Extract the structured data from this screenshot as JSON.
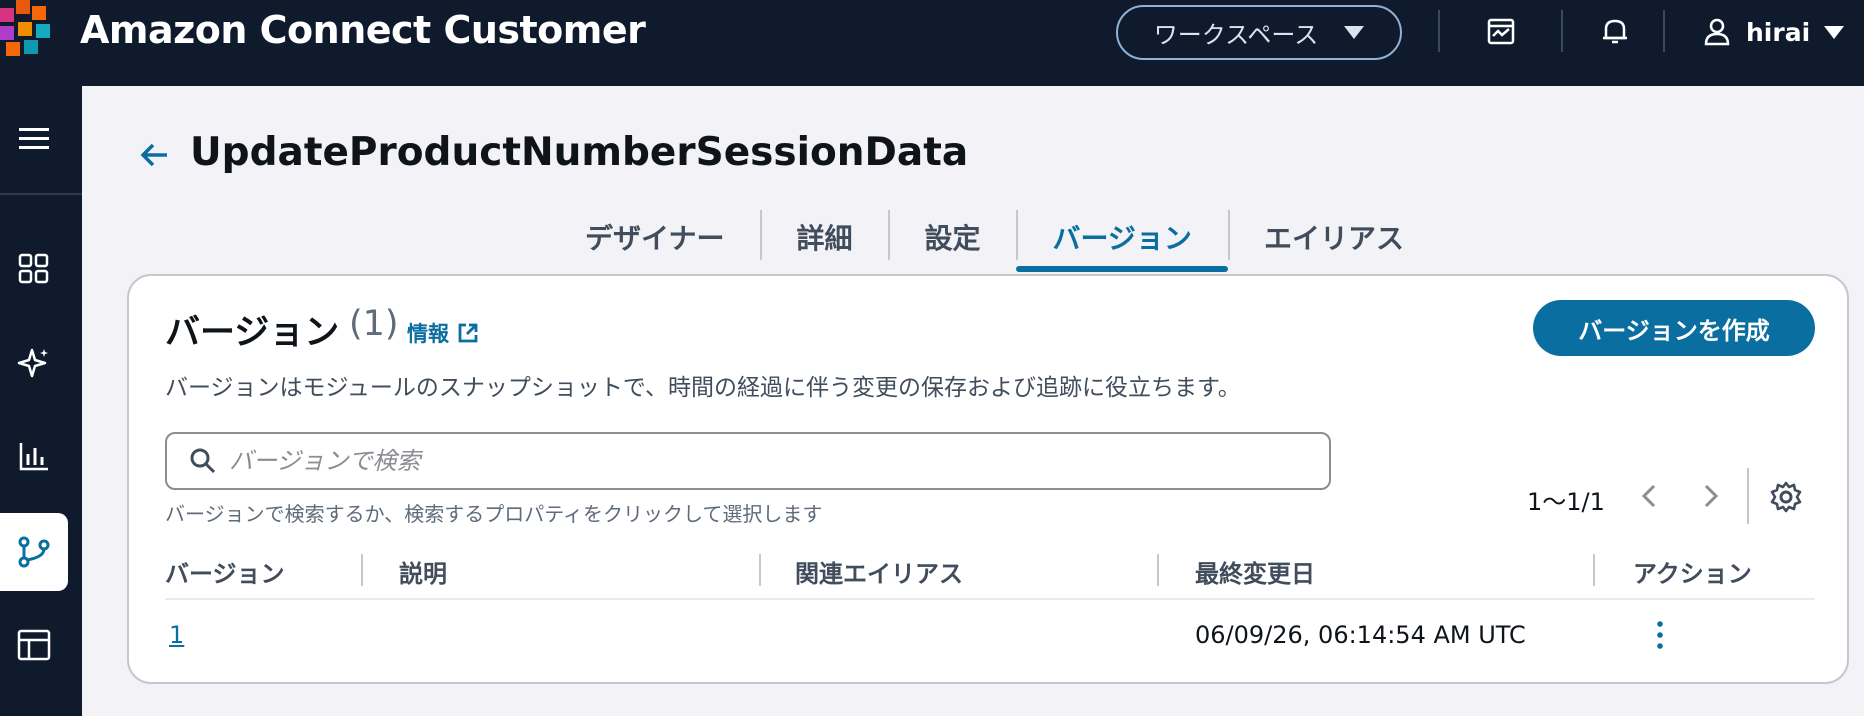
{
  "topbar": {
    "app_title": "Amazon Connect Customer",
    "workspace_label": "ワークスペース",
    "user_name": "hirai"
  },
  "colors": {
    "nav_bg": "#0f1b2d",
    "accent": "#0a6fa0",
    "page_bg": "#f3f3f7"
  },
  "sidebar": {
    "items": [
      {
        "icon": "menu-icon"
      },
      {
        "icon": "dashboard-icon"
      },
      {
        "icon": "sparkle-icon"
      },
      {
        "icon": "analytics-icon"
      },
      {
        "icon": "flow-icon",
        "active": true
      },
      {
        "icon": "layout-icon"
      }
    ]
  },
  "header": {
    "title": "UpdateProductNumberSessionData"
  },
  "tabs": [
    {
      "label": "デザイナー"
    },
    {
      "label": "詳細"
    },
    {
      "label": "設定"
    },
    {
      "label": "バージョン",
      "active": true
    },
    {
      "label": "エイリアス"
    }
  ],
  "versions": {
    "title": "バージョン",
    "count": "(1)",
    "info_link": "情報",
    "create_button": "バージョンを作成",
    "description": "バージョンはモジュールのスナップショットで、時間の経過に伴う変更の保存および追跡に役立ちます。",
    "search_placeholder": "バージョンで検索",
    "search_hint": "バージョンで検索するか、検索するプロパティをクリックして選択します",
    "pagination": "1〜1/1",
    "columns": [
      "バージョン",
      "説明",
      "関連エイリアス",
      "最終変更日",
      "アクション"
    ],
    "rows": [
      {
        "version": "1",
        "description": "",
        "aliases": "",
        "last_modified": "06/09/26, 06:14:54 AM UTC"
      }
    ]
  }
}
